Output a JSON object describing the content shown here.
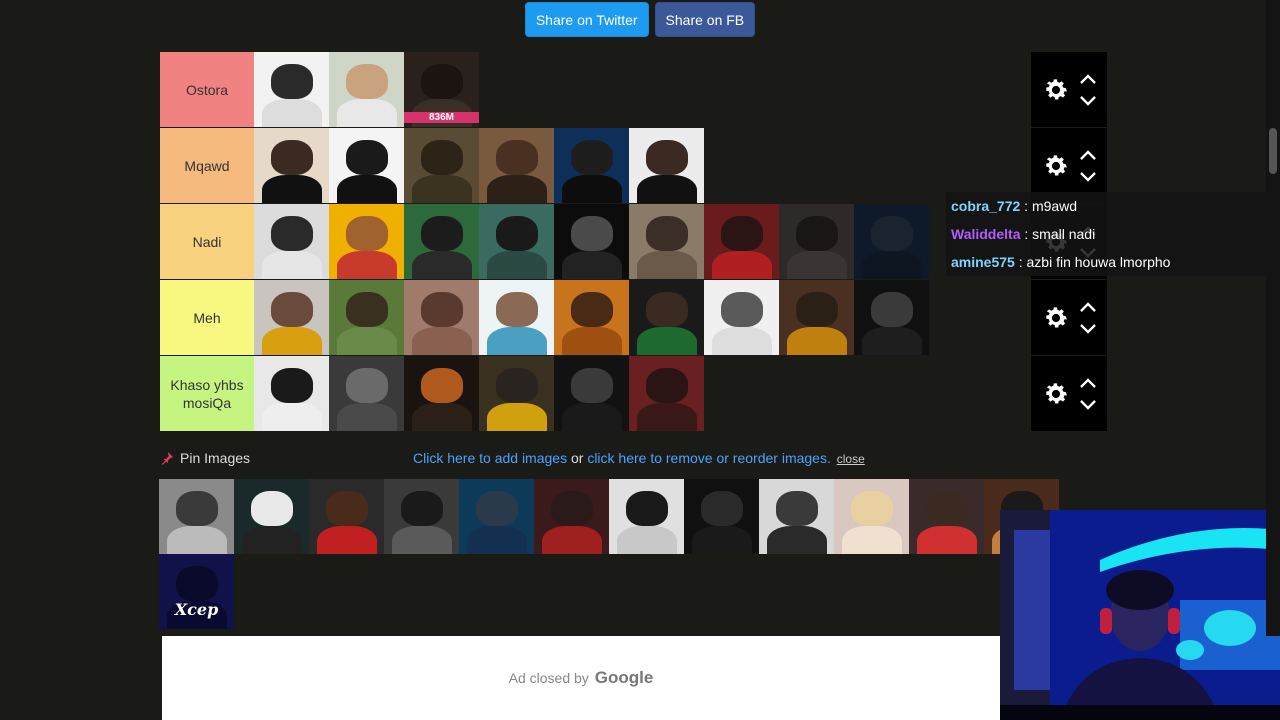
{
  "share": {
    "twitter_label": "Share on Twitter",
    "fb_label": "Share on FB"
  },
  "tiers": [
    {
      "label": "Ostora",
      "color": "#f08282",
      "tiles": [
        {
          "bg": "#f2f2f2",
          "head": "#2a2a2a",
          "body": "#dddddd"
        },
        {
          "bg": "#cfd6c8",
          "head": "#c9a27e",
          "body": "#e8e8e8"
        },
        {
          "bg": "#2b211c",
          "head": "#1b1410",
          "body": "#3a2e26",
          "badge": "836M"
        }
      ]
    },
    {
      "label": "Mqawd",
      "color": "#f6b97e",
      "tiles": [
        {
          "bg": "#e6d9c8",
          "head": "#3a2a22",
          "body": "#111111"
        },
        {
          "bg": "#f4f4f4",
          "head": "#1a1a1a",
          "body": "#111111"
        },
        {
          "bg": "#5a4b34",
          "head": "#2d2418",
          "body": "#3b3220"
        },
        {
          "bg": "#7a5a3e",
          "head": "#4a3020",
          "body": "#2d2016"
        },
        {
          "bg": "#0e2f5a",
          "head": "#1d1d1d",
          "body": "#0d0d0d"
        },
        {
          "bg": "#ececec",
          "head": "#3a2a22",
          "body": "#111111"
        }
      ]
    },
    {
      "label": "Nadi",
      "color": "#f8d27f",
      "tiles": [
        {
          "bg": "#dcdcdc",
          "head": "#2a2a2a",
          "body": "#e6e6e6"
        },
        {
          "bg": "#f0b000",
          "head": "#a0622e",
          "body": "#c83a2c"
        },
        {
          "bg": "#2c6a3c",
          "head": "#1c1c1c",
          "body": "#2a2a2a"
        },
        {
          "bg": "#3a6a60",
          "head": "#1a1a1a",
          "body": "#2b4a44"
        },
        {
          "bg": "#0c0c0c",
          "head": "#4a4a4a",
          "body": "#222222"
        },
        {
          "bg": "#8a7a68",
          "head": "#3a2e26",
          "body": "#6a5a4a"
        },
        {
          "bg": "#6a1c1c",
          "head": "#2a1414",
          "body": "#b02020"
        },
        {
          "bg": "#2e2a2a",
          "head": "#1a1616",
          "body": "#3a3434"
        },
        {
          "bg": "#0e1a2a",
          "head": "#1a2430",
          "body": "#0e1622"
        }
      ]
    },
    {
      "label": "Meh",
      "color": "#f8f880",
      "tiles": [
        {
          "bg": "#c9c4c0",
          "head": "#6a4a3a",
          "body": "#d8a010"
        },
        {
          "bg": "#5a7a3a",
          "head": "#3a3020",
          "body": "#6a8a4a"
        },
        {
          "bg": "#a07a6a",
          "head": "#5a3a2e",
          "body": "#8a6050"
        },
        {
          "bg": "#eef4f6",
          "head": "#8a6a56",
          "body": "#4aa0c0"
        },
        {
          "bg": "#c8741c",
          "head": "#4a2a14",
          "body": "#a05010"
        },
        {
          "bg": "#1a1a1a",
          "head": "#3a2a22",
          "body": "#1e6a2e"
        },
        {
          "bg": "#f0f0f0",
          "head": "#5a5a5a",
          "body": "#dddddd"
        },
        {
          "bg": "#4a3020",
          "head": "#2a2016",
          "body": "#c08010"
        },
        {
          "bg": "#101010",
          "head": "#3a3a3a",
          "body": "#1e1e1e"
        }
      ]
    },
    {
      "label": "Khaso yhbs mosiQa",
      "color": "#c6f480",
      "tiles": [
        {
          "bg": "#e8e8e8",
          "head": "#1a1a1a",
          "body": "#eeeeee"
        },
        {
          "bg": "#3a3a3a",
          "head": "#6a6a6a",
          "body": "#4a4a4a"
        },
        {
          "bg": "#1a1410",
          "head": "#b05a20",
          "body": "#2a2018"
        },
        {
          "bg": "#3a3020",
          "head": "#2a2420",
          "body": "#d0a010"
        },
        {
          "bg": "#121212",
          "head": "#3a3a3a",
          "body": "#1a1a1a"
        },
        {
          "bg": "#6a2020",
          "head": "#2a1414",
          "body": "#3a1818"
        }
      ]
    }
  ],
  "chat": [
    {
      "user": "cobra_772",
      "user_color": "#7fd4ff",
      "message": " : m9awd"
    },
    {
      "user": "Waliddelta",
      "user_color": "#b45cff",
      "message": " : small nadi"
    },
    {
      "user": "amine575",
      "user_color": "#7fd4ff",
      "message": " : azbi fin houwa lmorpho"
    }
  ],
  "pin": {
    "label": "Pin Images"
  },
  "links": {
    "add": "Click here to add images",
    "or": " or ",
    "remove": "click here to remove or reorder images.",
    "close": "close"
  },
  "pool": [
    {
      "bg": "#8a8a8a",
      "head": "#3a3a3a",
      "body": "#bbbbbb"
    },
    {
      "bg": "#1a2a2a",
      "head": "#e8e8e8",
      "body": "#222222"
    },
    {
      "bg": "#2a2a2a",
      "head": "#4a2a1a",
      "body": "#c02020"
    },
    {
      "bg": "#3a3a3a",
      "head": "#1a1a1a",
      "body": "#5a5a5a"
    },
    {
      "bg": "#0e3a5a",
      "head": "#2a3a4a",
      "body": "#143050"
    },
    {
      "bg": "#3a1a1a",
      "head": "#2a1a1a",
      "body": "#a02020"
    },
    {
      "bg": "#e0e0e0",
      "head": "#1a1a1a",
      "body": "#c8c8c8"
    },
    {
      "bg": "#101010",
      "head": "#2a2a2a",
      "body": "#1a1a1a"
    },
    {
      "bg": "#d8d8d8",
      "head": "#3a3a3a",
      "body": "#2a2a2a"
    },
    {
      "bg": "#d8c8c0",
      "head": "#e8d0a0",
      "body": "#f0e0d0"
    },
    {
      "bg": "#3a2a2a",
      "head": "#3a2a22",
      "body": "#d03030"
    },
    {
      "bg": "#4a2a1a",
      "head": "#1a1a1a",
      "body": "#c08040"
    },
    {
      "bg": "#12124a",
      "head": "#0a0a2a",
      "body": "#0a0a30",
      "caption": "Xcep"
    }
  ],
  "ad": {
    "text": "Ad closed by",
    "brand": "Google"
  },
  "colors": {
    "link": "#4aa3ff",
    "pin": "#e23c5a",
    "webcam_bg": "#071a88"
  }
}
